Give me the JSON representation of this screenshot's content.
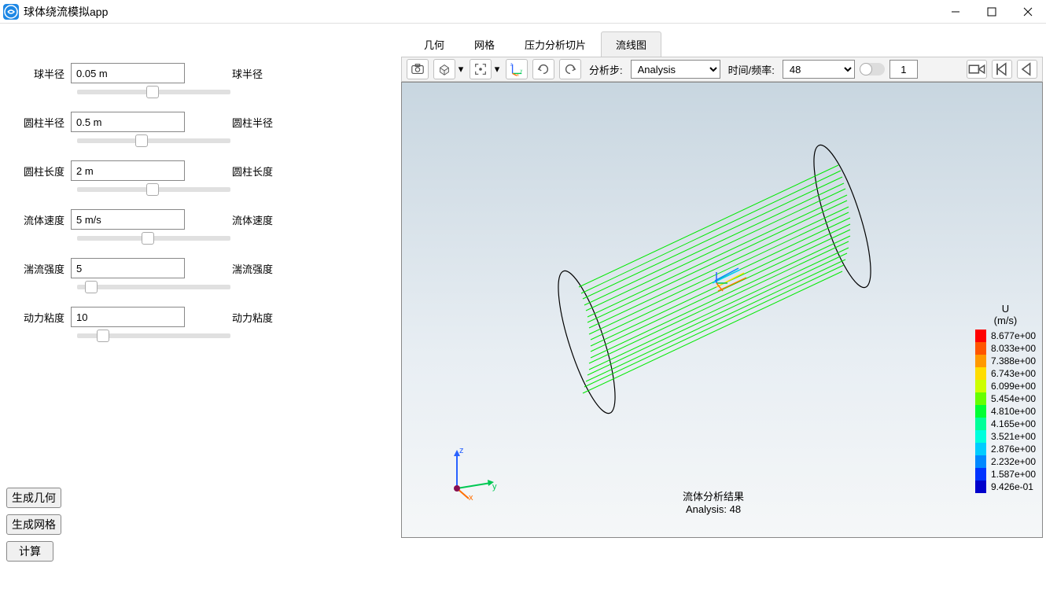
{
  "window": {
    "title": "球体绕流模拟app"
  },
  "params": [
    {
      "label": "球半径",
      "value": "0.05 m",
      "side": "球半径",
      "thumb": 45
    },
    {
      "label": "圆柱半径",
      "value": "0.5 m",
      "side": "圆柱半径",
      "thumb": 38
    },
    {
      "label": "圆柱长度",
      "value": "2 m",
      "side": "圆柱长度",
      "thumb": 45
    },
    {
      "label": "流体速度",
      "value": "5 m/s",
      "side": "流体速度",
      "thumb": 42
    },
    {
      "label": "湍流强度",
      "value": "5",
      "side": "湍流强度",
      "thumb": 5
    },
    {
      "label": "动力粘度",
      "value": "10",
      "side": "动力粘度",
      "thumb": 13
    }
  ],
  "buttons": {
    "geom": "生成几何",
    "mesh": "生成网格",
    "calc": "计算"
  },
  "tabs": [
    "几何",
    "网格",
    "压力分析切片",
    "流线图"
  ],
  "active_tab": 3,
  "toolbar": {
    "analysis_label": "分析步:",
    "analysis_value": "Analysis",
    "time_label": "时间/频率:",
    "time_value": "48",
    "spin_value": "1"
  },
  "viewport": {
    "result_title": "流体分析结果",
    "result_sub": "Analysis: 48"
  },
  "legend": {
    "title": "U",
    "unit": "(m/s)",
    "items": [
      {
        "c": "#ff0000",
        "v": "8.677e+00"
      },
      {
        "c": "#ff5500",
        "v": "8.033e+00"
      },
      {
        "c": "#ff9900",
        "v": "7.388e+00"
      },
      {
        "c": "#ffdd00",
        "v": "6.743e+00"
      },
      {
        "c": "#ccff00",
        "v": "6.099e+00"
      },
      {
        "c": "#66ff00",
        "v": "5.454e+00"
      },
      {
        "c": "#00ff33",
        "v": "4.810e+00"
      },
      {
        "c": "#00ff99",
        "v": "4.165e+00"
      },
      {
        "c": "#00ffdd",
        "v": "3.521e+00"
      },
      {
        "c": "#00ccff",
        "v": "2.876e+00"
      },
      {
        "c": "#0088ff",
        "v": "2.232e+00"
      },
      {
        "c": "#0033ff",
        "v": "1.587e+00"
      },
      {
        "c": "#0000cc",
        "v": "9.426e-01"
      }
    ]
  }
}
